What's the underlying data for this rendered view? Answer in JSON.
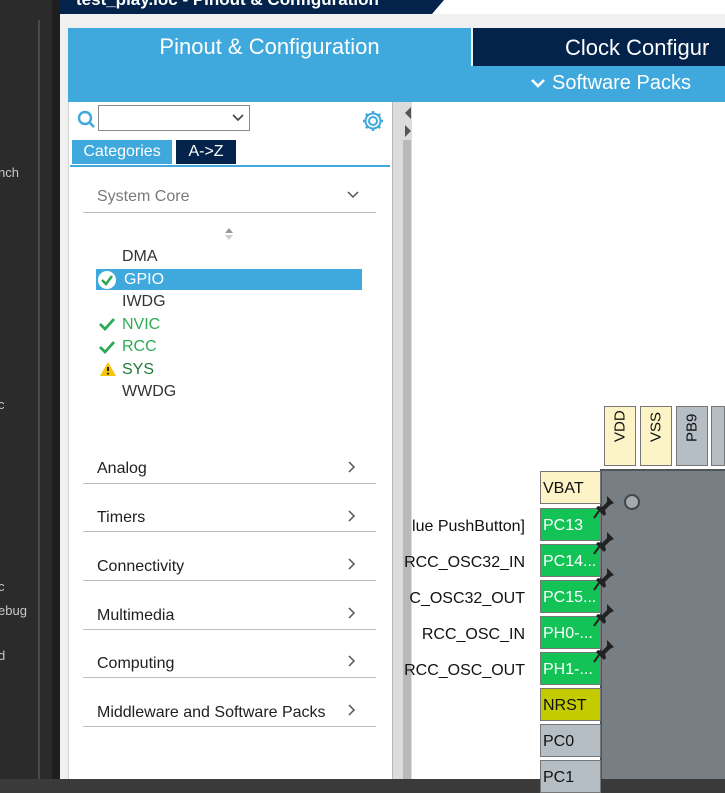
{
  "window": {
    "title": "test_play.ioc - Pinout & Configuration"
  },
  "left_strip": {
    "fragments": [
      "nch",
      "c",
      "c",
      "ebug",
      "d"
    ]
  },
  "tabs": {
    "pinout": "Pinout & Configuration",
    "clock": "Clock Configur",
    "software_packs": "Software Packs"
  },
  "panel": {
    "search_value": "",
    "view_buttons": {
      "categories": "Categories",
      "az": "A->Z"
    },
    "categories": [
      {
        "label": "System Core",
        "expanded": true
      },
      {
        "label": "Analog"
      },
      {
        "label": "Timers"
      },
      {
        "label": "Connectivity"
      },
      {
        "label": "Multimedia"
      },
      {
        "label": "Computing"
      },
      {
        "label": "Middleware and Software Packs"
      }
    ],
    "system_core_items": [
      {
        "label": "DMA",
        "status": "none"
      },
      {
        "label": "GPIO",
        "status": "ok",
        "selected": true
      },
      {
        "label": "IWDG",
        "status": "none"
      },
      {
        "label": "NVIC",
        "status": "ok"
      },
      {
        "label": "RCC",
        "status": "ok"
      },
      {
        "label": "SYS",
        "status": "warning"
      },
      {
        "label": "WWDG",
        "status": "none"
      }
    ]
  },
  "chip_view": {
    "top_pins": [
      "VDD",
      "VSS",
      "PB9"
    ],
    "left_pins": [
      {
        "pin": "VBAT",
        "signal": ""
      },
      {
        "pin": "PC13",
        "signal": "lue PushButton]"
      },
      {
        "pin": "PC14...",
        "signal": "RCC_OSC32_IN"
      },
      {
        "pin": "PC15...",
        "signal": "C_OSC32_OUT"
      },
      {
        "pin": "PH0-...",
        "signal": "RCC_OSC_IN"
      },
      {
        "pin": "PH1-...",
        "signal": "RCC_OSC_OUT"
      },
      {
        "pin": "NRST",
        "signal": ""
      },
      {
        "pin": "PC0",
        "signal": ""
      },
      {
        "pin": "PC1",
        "signal": ""
      }
    ]
  },
  "colors": {
    "tab_active": "#3fa9dd",
    "tab_inactive": "#03234b",
    "pin_assigned": "#14c356",
    "pin_power": "#fcf3c6",
    "pin_reset": "#c4cb00",
    "pin_free": "#b6bec5",
    "status_ok": "#2eaa56",
    "status_warning": "#f5c400"
  }
}
